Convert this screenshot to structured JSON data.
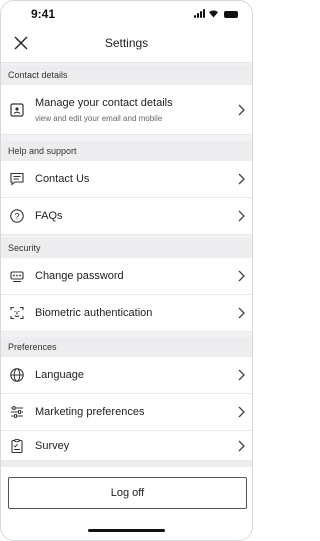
{
  "status_bar": {
    "time": "9:41"
  },
  "header": {
    "title": "Settings"
  },
  "sections": {
    "contact_details": "Contact details",
    "help_and_support": "Help and support",
    "security": "Security",
    "preferences": "Preferences"
  },
  "items": {
    "manage_contact": {
      "label": "Manage your contact details",
      "sublabel": "view and edit your email and mobile",
      "icon": "contact-card-icon"
    },
    "contact_us": {
      "label": "Contact Us",
      "icon": "message-icon"
    },
    "faqs": {
      "label": "FAQs",
      "icon": "question-circle-icon"
    },
    "change_password": {
      "label": "Change password",
      "icon": "password-icon"
    },
    "biometric": {
      "label": "Biometric authentication",
      "icon": "face-id-icon"
    },
    "language": {
      "label": "Language",
      "icon": "globe-icon"
    },
    "marketing": {
      "label": "Marketing preferences",
      "icon": "sliders-icon"
    },
    "survey": {
      "label": "Survey",
      "icon": "survey-icon"
    }
  },
  "footer": {
    "logoff_label": "Log off"
  }
}
